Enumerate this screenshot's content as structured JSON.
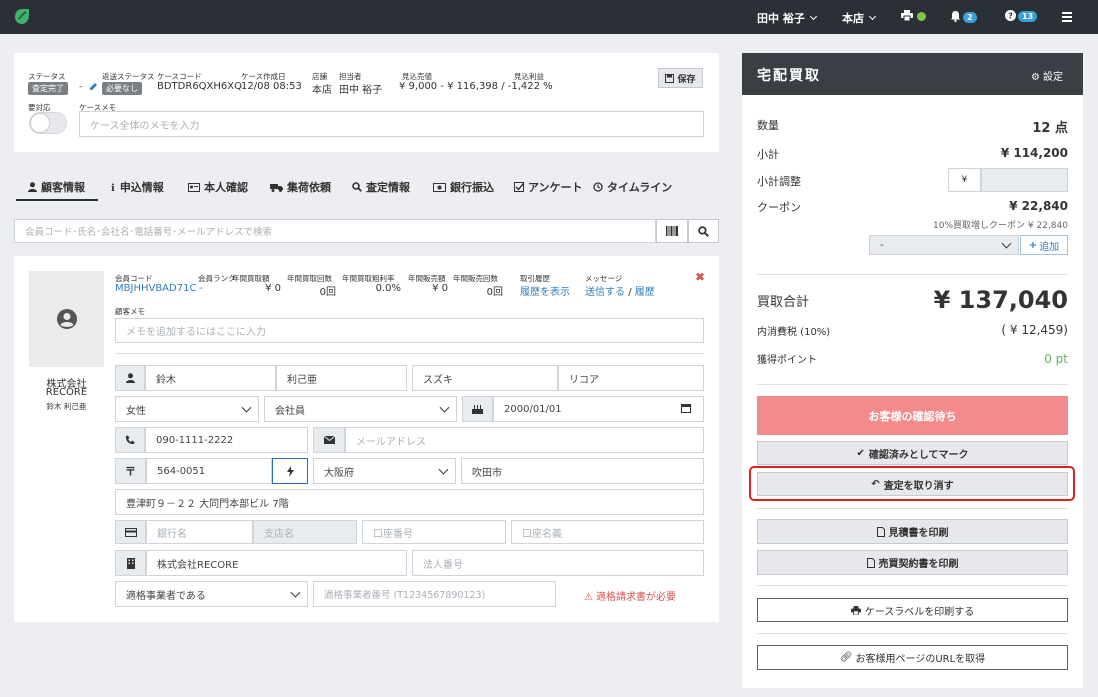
{
  "topbar": {
    "user_name": "田中 裕子",
    "store": "本店",
    "notifications_count": "2",
    "help_count": "13",
    "status_color": "#7ac943"
  },
  "case": {
    "status_label": "ステータス",
    "status_value": "査定完了",
    "shipping_label": "返送ステータス",
    "shipping_dash": "-",
    "shipping_value": "必要なし",
    "code_label": "ケースコード",
    "code_value": "BDTDR6QXH6XQ",
    "created_label": "ケース作成日",
    "created_value": "12/08 08:53",
    "store_label": "店舗",
    "store_value": "本店",
    "staff_label": "担当者",
    "staff_value": "田中 裕子",
    "est_sales_label": "見込売値",
    "est_sales_value": "¥ 9,000 - ¥ 116,398 / -1,422 %",
    "est_profit_label": "見込利益",
    "save_button": "保存",
    "needs_action_label": "要対応",
    "memo_label": "ケースメモ",
    "memo_placeholder": "ケース全体のメモを入力"
  },
  "tabs": [
    {
      "label": "顧客情報",
      "icon": "user-icon"
    },
    {
      "label": "申込情報",
      "icon": "info-icon"
    },
    {
      "label": "本人確認",
      "icon": "id-card-icon"
    },
    {
      "label": "集荷依頼",
      "icon": "truck-icon"
    },
    {
      "label": "査定情報",
      "icon": "search-icon"
    },
    {
      "label": "銀行振込",
      "icon": "money-icon"
    },
    {
      "label": "アンケート",
      "icon": "checkbox-icon"
    },
    {
      "label": "タイムライン",
      "icon": "history-icon"
    }
  ],
  "search": {
    "placeholder": "会員コード･氏名･会社名･電話番号･メールアドレスで検索"
  },
  "customer": {
    "company_name": "株式会社",
    "company_name2": "RECORE",
    "person_name": "鈴木 利己亜",
    "member_code_label": "会員コード",
    "member_code": "MBJHHVBAD71C",
    "rank_label": "会員ランク",
    "rank_value": "-",
    "annual_buy_amount_label": "年間買取額",
    "annual_buy_amount": "¥ 0",
    "annual_buy_count_label": "年間買取回数",
    "annual_buy_count": "0回",
    "annual_margin_label": "年間買取粗利率",
    "annual_margin": "0.0%",
    "annual_sales_amount_label": "年間販売額",
    "annual_sales_amount": "¥ 0",
    "annual_sales_count_label": "年間販売回数",
    "annual_sales_count": "0回",
    "history_label": "取引履歴",
    "history_link": "履歴を表示",
    "message_label": "メッセージ",
    "message_send": "送信する",
    "message_sep": "/",
    "message_history": "履歴",
    "memo_label": "顧客メモ",
    "memo_placeholder": "メモを追加するにはここに入力",
    "last_name": "鈴木",
    "first_name": "利己亜",
    "last_kana": "スズキ",
    "first_kana": "リコア",
    "gender": "女性",
    "member_type": "会社員",
    "birthday": "2000/01/01",
    "phone": "090-1111-2222",
    "email_placeholder": "メールアドレス",
    "zip": "564-0051",
    "prefecture": "大阪府",
    "city": "吹田市",
    "address": "豊津町９－２２ 大同門本部ビル 7階",
    "bank_placeholder": "銀行名",
    "branch_placeholder": "支店名",
    "account_no_placeholder": "口座番号",
    "account_name_placeholder": "口座名義",
    "company": "株式会社RECORE",
    "corp_no_placeholder": "法人番号",
    "invoice_type": "適格事業者である",
    "invoice_no_placeholder": "適格事業者番号 (T1234567890123)",
    "invoice_warning": "適格請求書が必要"
  },
  "right": {
    "title": "宅配買取",
    "settings": "設定",
    "qty_label": "数量",
    "qty_value": "12 点",
    "subtotal_label": "小計",
    "subtotal_value": "¥ 114,200",
    "adjust_label": "小計調整",
    "adjust_prefix": "¥",
    "coupon_label": "クーポン",
    "coupon_value": "¥ 22,840",
    "coupon_note": "10%買取増しクーポン ¥ 22,840",
    "coupon_select": "-",
    "add_button": "追加",
    "total_label": "買取合計",
    "total_value": "¥ 137,040",
    "tax_label": "内消費税 (10%)",
    "tax_value": "( ¥ 12,459)",
    "points_label": "獲得ポイント",
    "points_value": "0 pt",
    "await_button": "お客様の確認待ち",
    "mark_button": "確認済みとしてマーク",
    "cancel_button": "査定を取り消す",
    "estimate_button": "見積書を印刷",
    "contract_button": "売買契約書を印刷",
    "label_button": "ケースラベルを印刷する",
    "url_button": "お客様用ページのURLを取得",
    "accent_red": "#f28b8b",
    "highlight_red": "#e02020",
    "points_green": "#5cb85c"
  }
}
